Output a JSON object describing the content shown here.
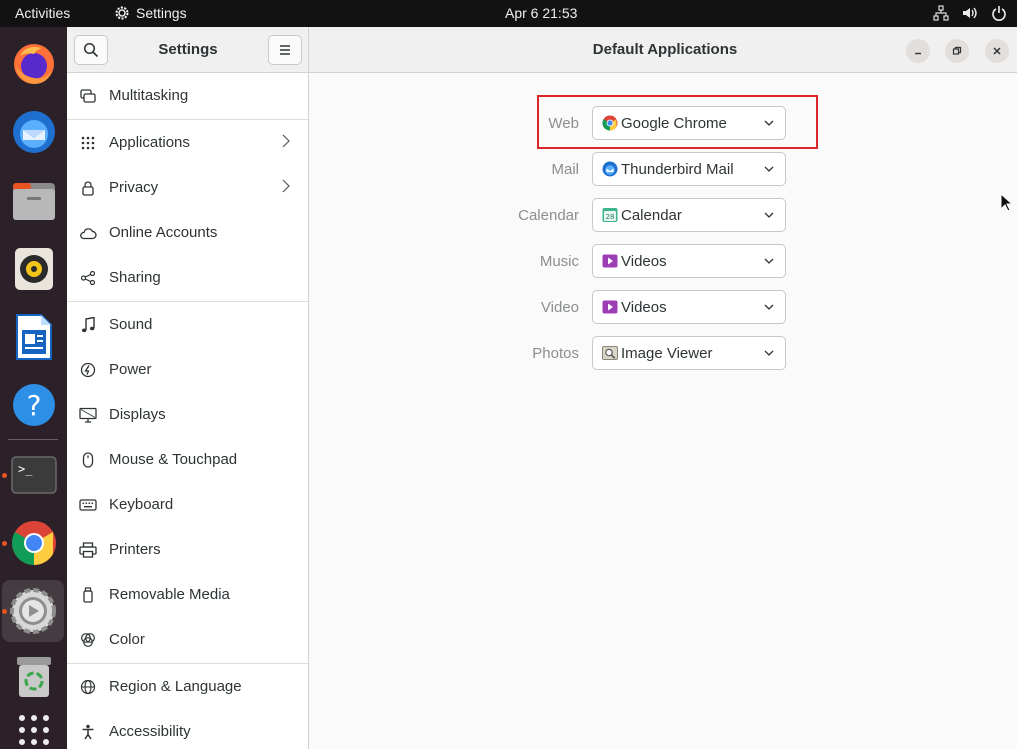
{
  "topbar": {
    "activities": "Activities",
    "app_name": "Settings",
    "datetime": "Apr 6  21:53",
    "tray_icons": [
      "network-icon",
      "volume-icon",
      "power-icon"
    ]
  },
  "dock": {
    "apps": [
      "firefox-icon",
      "thunderbird-icon",
      "files-icon",
      "rhythmbox-icon",
      "writer-icon",
      "help-icon",
      "terminal-icon",
      "chrome-icon",
      "settings-icon",
      "trash-icon",
      "app-grid-icon"
    ]
  },
  "sidebar": {
    "title": "Settings",
    "items": [
      {
        "label": "Multitasking",
        "icon": "multitasking-icon",
        "chevron": false
      },
      {
        "label": "Applications",
        "icon": "applications-icon",
        "chevron": true
      },
      {
        "label": "Privacy",
        "icon": "lock-icon",
        "chevron": true
      },
      {
        "label": "Online Accounts",
        "icon": "cloud-icon",
        "chevron": false
      },
      {
        "label": "Sharing",
        "icon": "share-icon",
        "chevron": false
      },
      {
        "label": "Sound",
        "icon": "music-note-icon",
        "chevron": false
      },
      {
        "label": "Power",
        "icon": "power-icon",
        "chevron": false
      },
      {
        "label": "Displays",
        "icon": "display-icon",
        "chevron": false
      },
      {
        "label": "Mouse & Touchpad",
        "icon": "mouse-icon",
        "chevron": false
      },
      {
        "label": "Keyboard",
        "icon": "keyboard-icon",
        "chevron": false
      },
      {
        "label": "Printers",
        "icon": "printer-icon",
        "chevron": false
      },
      {
        "label": "Removable Media",
        "icon": "usb-icon",
        "chevron": false
      },
      {
        "label": "Color",
        "icon": "color-icon",
        "chevron": false
      },
      {
        "label": "Region & Language",
        "icon": "globe-icon",
        "chevron": false
      },
      {
        "label": "Accessibility",
        "icon": "accessibility-icon",
        "chevron": false
      }
    ]
  },
  "main": {
    "title": "Default Applications",
    "defaults": [
      {
        "label": "Web",
        "value": "Google Chrome",
        "icon": "chrome-icon"
      },
      {
        "label": "Mail",
        "value": "Thunderbird Mail",
        "icon": "thunderbird-icon"
      },
      {
        "label": "Calendar",
        "value": "Calendar",
        "icon": "calendar-icon"
      },
      {
        "label": "Music",
        "value": "Videos",
        "icon": "videos-icon"
      },
      {
        "label": "Video",
        "value": "Videos",
        "icon": "videos-icon"
      },
      {
        "label": "Photos",
        "value": "Image Viewer",
        "icon": "image-viewer-icon"
      }
    ]
  },
  "colors": {
    "accent": "#e95420",
    "highlight": "#d9262b",
    "topbar": "#121212",
    "dock": "#2c2128"
  }
}
